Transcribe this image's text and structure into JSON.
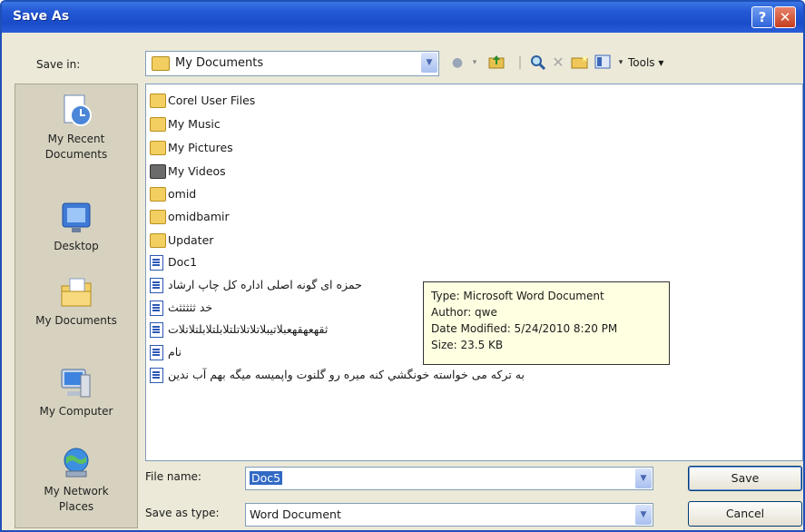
{
  "window": {
    "title": "Save As",
    "help_glyph": "?",
    "close_glyph": "✕"
  },
  "save_in": {
    "label": "Save in:",
    "value": "My Documents",
    "tools_label": "Tools"
  },
  "places": [
    {
      "label_line1": "My Recent",
      "label_line2": "Documents",
      "icon": "recent-documents-icon"
    },
    {
      "label_line1": "Desktop",
      "label_line2": "",
      "icon": "desktop-icon"
    },
    {
      "label_line1": "My Documents",
      "label_line2": "",
      "icon": "my-documents-icon"
    },
    {
      "label_line1": "My Computer",
      "label_line2": "",
      "icon": "my-computer-icon"
    },
    {
      "label_line1": "My Network",
      "label_line2": "Places",
      "icon": "network-places-icon"
    }
  ],
  "files": [
    {
      "name": "Corel User Files",
      "kind": "folder"
    },
    {
      "name": "My Music",
      "kind": "folder"
    },
    {
      "name": "My Pictures",
      "kind": "folder"
    },
    {
      "name": "My Videos",
      "kind": "folder"
    },
    {
      "name": "omid",
      "kind": "folder"
    },
    {
      "name": "omidbamir",
      "kind": "folder"
    },
    {
      "name": "Updater",
      "kind": "folder"
    },
    {
      "name": "Doc1",
      "kind": "doc"
    },
    {
      "name": "حمزه ای گونه اصلی اداره کل چاپ ارشاد",
      "kind": "doc"
    },
    {
      "name": "خد ثثثثثث",
      "kind": "doc"
    },
    {
      "name": "ثقهعهقهعبلاتيبلاتلاتلاتلتلابلتلابلتلاتلات",
      "kind": "doc"
    },
    {
      "name": "نام",
      "kind": "doc"
    },
    {
      "name": "به ترکه می خواسته خونگشي کنه میره رو گلنوت واپمیسه میگه بهم آب ندین",
      "kind": "doc"
    }
  ],
  "tooltip": {
    "type": "Type: Microsoft Word Document",
    "author": "Author: qwe",
    "modified": "Date Modified: 5/24/2010 8:20 PM",
    "size": "Size: 23.5 KB"
  },
  "file_name": {
    "label": "File name:",
    "value": "Doc5"
  },
  "save_as_type": {
    "label": "Save as type:",
    "value": "Word Document"
  },
  "buttons": {
    "save": "Save",
    "cancel": "Cancel"
  }
}
